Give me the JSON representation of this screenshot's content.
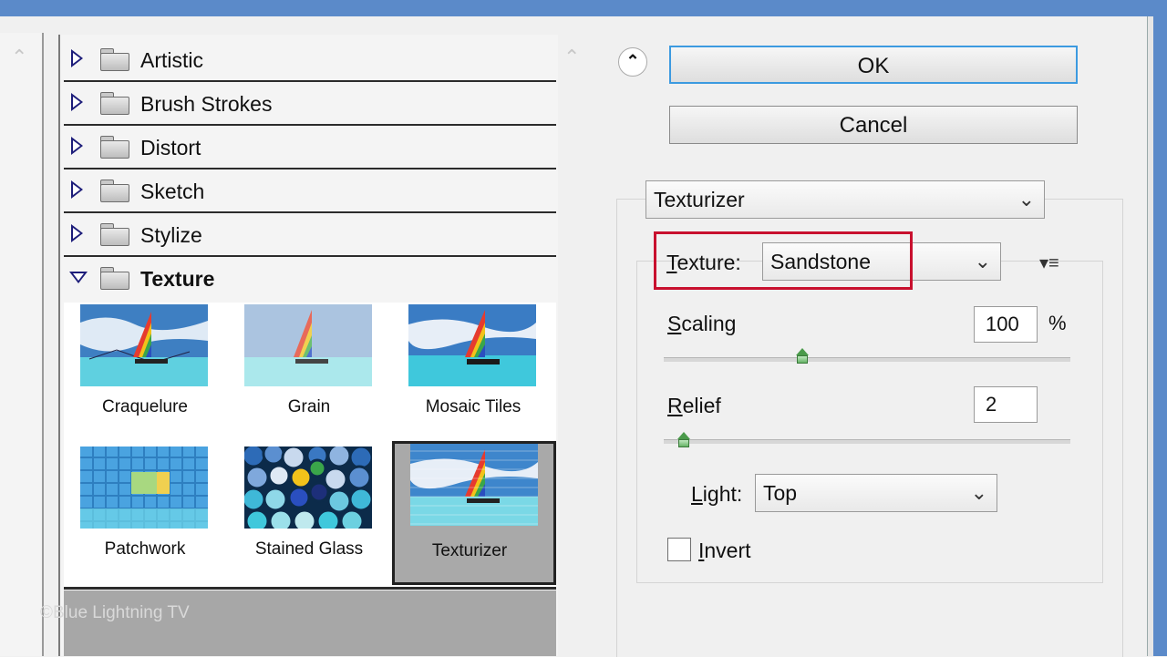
{
  "gallery": {
    "folders": [
      {
        "label": "Artistic",
        "open": false
      },
      {
        "label": "Brush Strokes",
        "open": false
      },
      {
        "label": "Distort",
        "open": false
      },
      {
        "label": "Sketch",
        "open": false
      },
      {
        "label": "Stylize",
        "open": false
      },
      {
        "label": "Texture",
        "open": true
      }
    ],
    "thumbnails": [
      {
        "label": "Craquelure"
      },
      {
        "label": "Grain"
      },
      {
        "label": "Mosaic Tiles"
      },
      {
        "label": "Patchwork"
      },
      {
        "label": "Stained Glass"
      },
      {
        "label": "Texturizer",
        "selected": true
      }
    ],
    "watermark": "©Blue Lightning TV"
  },
  "buttons": {
    "ok": "OK",
    "cancel": "Cancel"
  },
  "controls": {
    "filter": "Texturizer",
    "texture_label_first": "T",
    "texture_label_rest": "exture:",
    "texture_value": "Sandstone",
    "scaling_label_first": "S",
    "scaling_label_rest": "caling",
    "scaling_value": "100",
    "scaling_unit": "%",
    "relief_label_first": "R",
    "relief_label_rest": "elief",
    "relief_value": "2",
    "light_label_first": "L",
    "light_label_rest": "ight:",
    "light_value": "Top",
    "invert_label_first": "I",
    "invert_label_rest": "nvert",
    "invert_checked": false
  },
  "colors": {
    "titlebar": "#5b8ac9",
    "highlight": "#c8102e",
    "ok_border": "#3c9ae0"
  }
}
